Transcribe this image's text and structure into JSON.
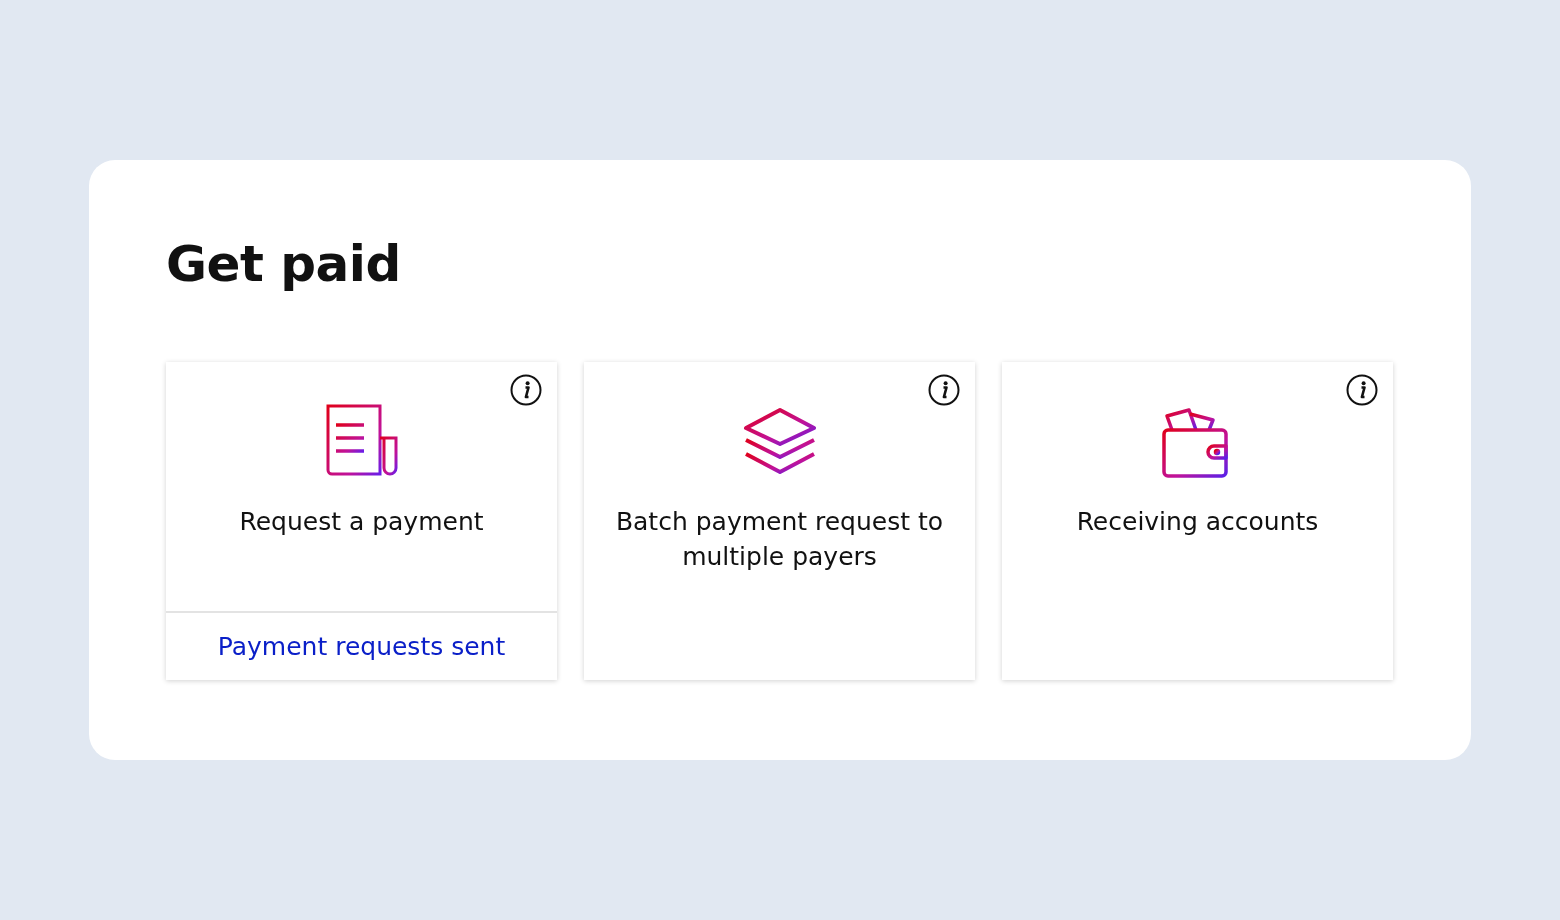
{
  "title": "Get paid",
  "cards": [
    {
      "kind": "invoice",
      "label": "Request a payment",
      "link": "Payment requests sent"
    },
    {
      "kind": "layers",
      "label": "Batch payment request to multiple payers"
    },
    {
      "kind": "wallet",
      "label": "Receiving accounts"
    }
  ]
}
